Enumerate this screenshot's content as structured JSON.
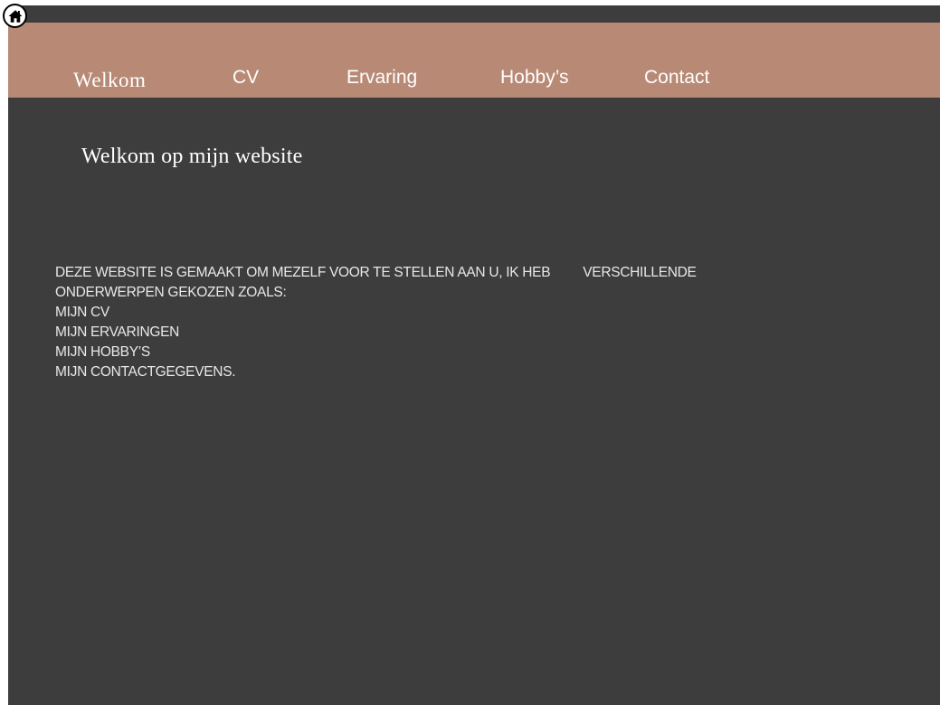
{
  "nav": {
    "items": [
      {
        "label": "Welkom"
      },
      {
        "label": "CV"
      },
      {
        "label": "Ervaring"
      },
      {
        "label": "Hobby’s"
      },
      {
        "label": "Contact"
      }
    ]
  },
  "icons": {
    "home": "home-icon"
  },
  "main": {
    "title": "Welkom op mijn website",
    "intro_part1": "DEZE WEBSITE IS GEMAAKT OM MEZELF VOOR TE STELLEN AAN U, IK HEB",
    "intro_part2": "VERSCHILLENDE",
    "intro_line2": "ONDERWERPEN GEKOZEN ZOALS:",
    "topics": [
      "MIJN CV",
      "MIJN ERVARINGEN",
      "MIJN HOBBY’S",
      "MIJN CONTACTGEGEVENS."
    ]
  },
  "colors": {
    "background": "#3d3d3d",
    "nav_bar": "#b88a76",
    "text": "#ffffff"
  }
}
